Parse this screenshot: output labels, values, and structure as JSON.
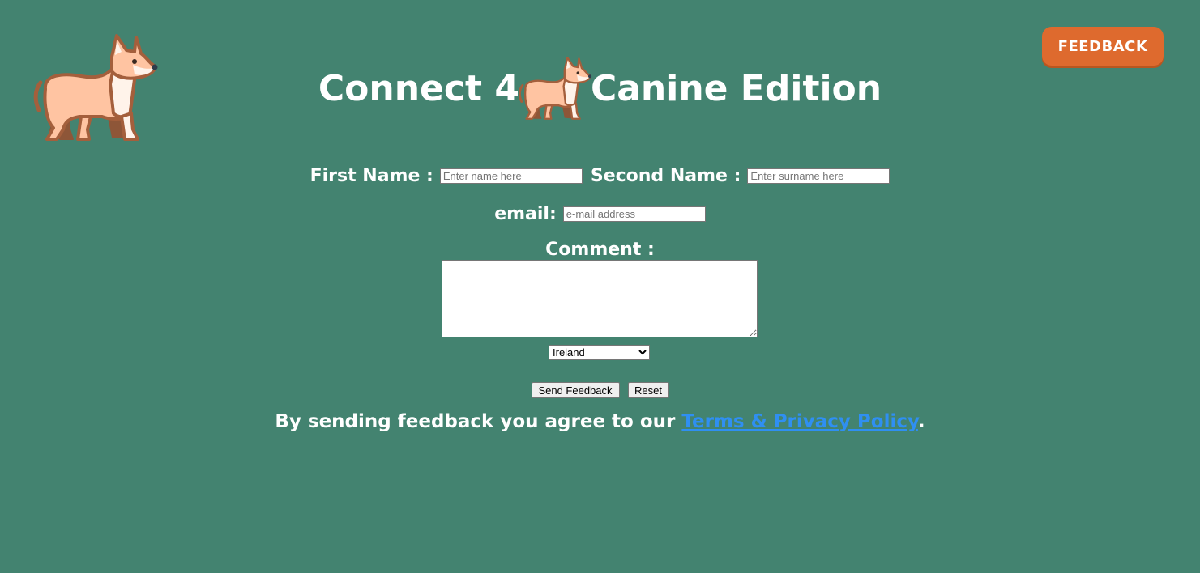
{
  "header": {
    "feedback_button": "FEEDBACK",
    "title_left": "Connect 4",
    "title_right": "Canine Edition",
    "logo_icon": "dog-icon"
  },
  "form": {
    "first_name_label": "First Name :",
    "first_name_placeholder": "Enter name here",
    "first_name_value": "",
    "second_name_label": "Second Name :",
    "second_name_placeholder": "Enter surname here",
    "second_name_value": "",
    "email_label": "email:",
    "email_placeholder": "e-mail address",
    "email_value": "",
    "comment_label": "Comment :",
    "comment_value": "",
    "country_selected": "Ireland",
    "send_button": "Send Feedback",
    "reset_button": "Reset"
  },
  "footer": {
    "agree_text": "By sending feedback you agree to our",
    "policy_link": "Terms & Privacy Policy",
    "agree_end": "."
  },
  "colors": {
    "background": "#438370",
    "feedback_button": "#de6a2e",
    "link": "#2f8ff2",
    "text": "#ffffff"
  }
}
